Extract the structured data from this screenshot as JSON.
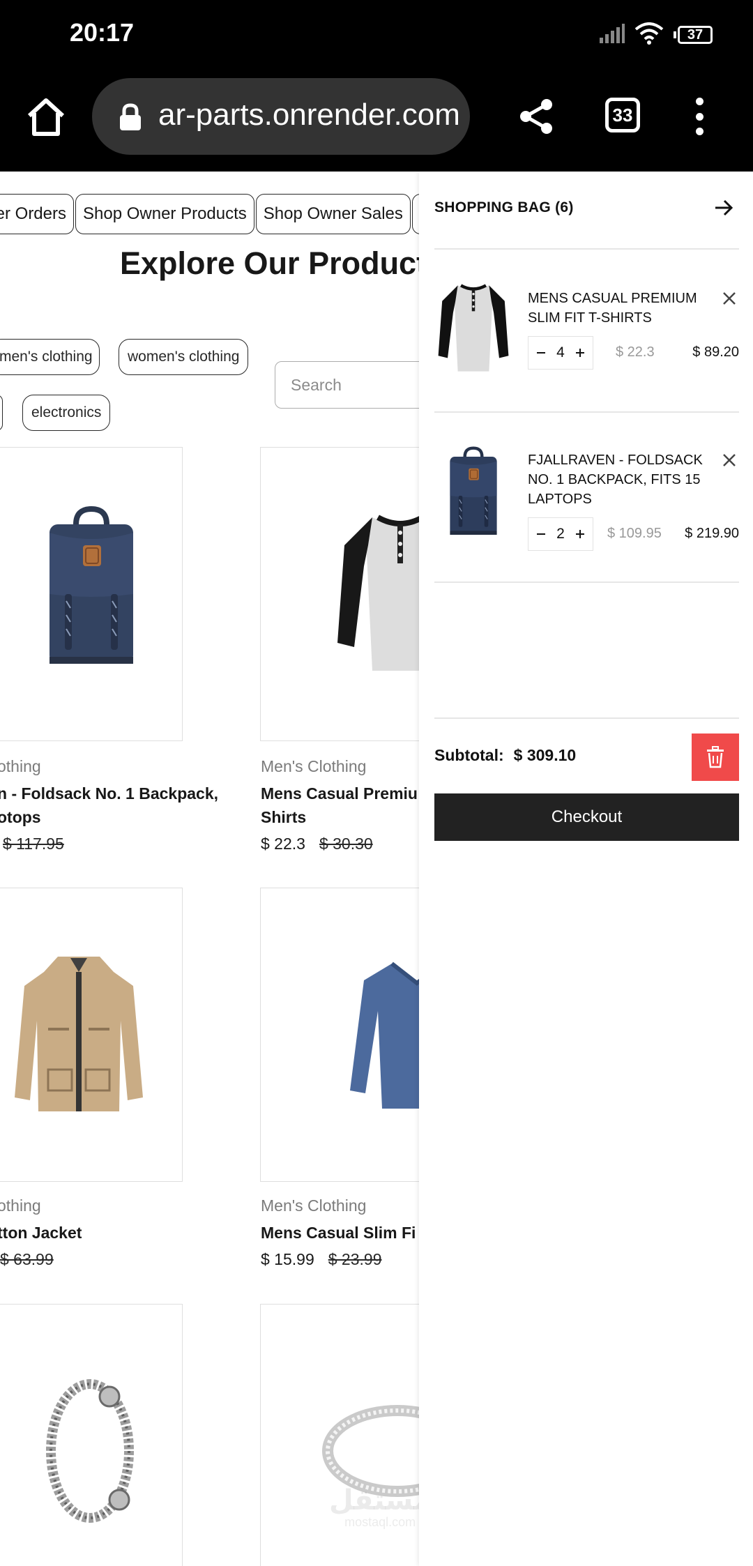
{
  "status_bar": {
    "time": "20:17",
    "battery": "37"
  },
  "browser": {
    "url": "ar-parts.onrender.com",
    "tab_count": "33"
  },
  "nav_tabs": [
    "er Orders",
    "Shop Owner Products",
    "Shop Owner Sales",
    ""
  ],
  "page_title": "Explore Our Products",
  "categories": [
    "men's clothing",
    "women's clothing",
    "",
    "electronics"
  ],
  "search": {
    "placeholder": "Search"
  },
  "products": [
    {
      "category": "othing",
      "name": "n - Foldsack No. 1 Backpack, otops",
      "price": "",
      "old_price": "$ 117.95",
      "image": "backpack"
    },
    {
      "category": "Men's Clothing",
      "name": "Mens Casual Premiu Shirts",
      "price": "$ 22.3",
      "old_price": "$ 30.30",
      "image": "henley-tshirt"
    },
    {
      "category": "othing",
      "name": "tton Jacket",
      "price": "",
      "old_price": "$ 63.99",
      "image": "cotton-jacket"
    },
    {
      "category": "Men's Clothing",
      "name": "Mens Casual Slim Fi",
      "price": "$ 15.99",
      "old_price": "$ 23.99",
      "image": "slim-fit-longsleeve"
    },
    {
      "category": "",
      "name": "",
      "price": "",
      "old_price": "",
      "image": "dragon-bracelet"
    },
    {
      "category": "",
      "name": "",
      "price": "",
      "old_price": "",
      "image": "silver-ring"
    }
  ],
  "cart": {
    "title": "SHOPPING BAG (6)",
    "items": [
      {
        "name": "Mens Casual Premium Slim Fit T-Shirts",
        "quantity": "4",
        "unit_price": "$ 22.3",
        "line_total": "$ 89.20",
        "image": "henley-tshirt"
      },
      {
        "name": "Fjallraven - Foldsack No. 1 Backpack, Fits 15 Laptops",
        "quantity": "2",
        "unit_price": "$ 109.95",
        "line_total": "$ 219.90",
        "image": "backpack"
      }
    ],
    "subtotal_label": "Subtotal:",
    "subtotal_value": "$ 309.10",
    "checkout_label": "Checkout"
  },
  "watermark": {
    "text": "مستقل",
    "sub": "mostaql.com"
  },
  "colors": {
    "danger": "#f04a4a",
    "dark_button": "#222222",
    "browser_chrome": "#000000",
    "url_field": "#333333"
  }
}
